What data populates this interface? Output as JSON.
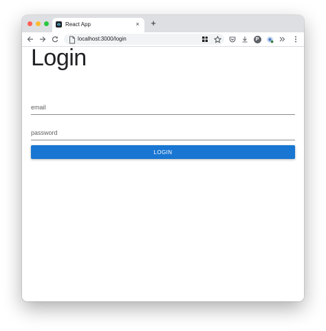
{
  "browser": {
    "tab_title": "React App",
    "tab_close": "×",
    "new_tab": "+",
    "url": "localhost:3000/login",
    "profile_initial": "P",
    "colors": {
      "tabstrip": "#dedfe2",
      "close": "#fe5f57",
      "minimize": "#febc2e",
      "zoom": "#28c840"
    },
    "icons": [
      "back-arrow-icon",
      "forward-arrow-icon",
      "reload-icon",
      "page-icon",
      "extensions-grid-icon",
      "bookmark-star-icon",
      "pocket-icon",
      "download-icon",
      "profile-avatar",
      "extension-icon",
      "chevron-more-icon",
      "kebab-menu-icon"
    ]
  },
  "page": {
    "title": "Login",
    "email_placeholder": "email",
    "password_placeholder": "password",
    "login_label": "LOGIN",
    "accent": "#1976d2"
  }
}
